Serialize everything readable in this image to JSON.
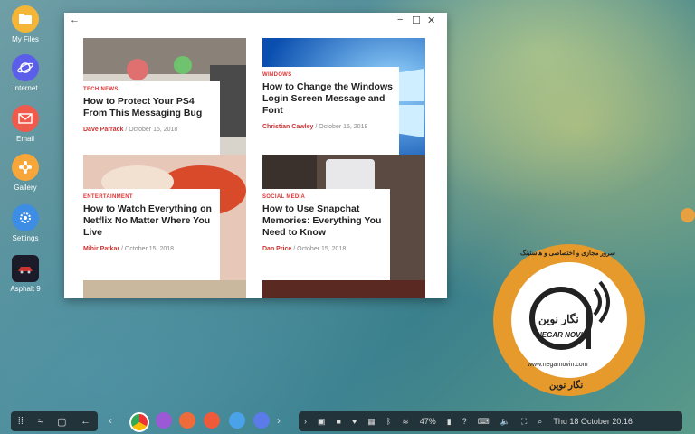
{
  "desktop": {
    "icons": [
      {
        "label": "My Files",
        "icon": "folder-icon",
        "color": "#f5b638"
      },
      {
        "label": "Internet",
        "icon": "planet-icon",
        "color": "#5b5ee8"
      },
      {
        "label": "Email",
        "icon": "envelope-icon",
        "color": "#ef5a4c"
      },
      {
        "label": "Gallery",
        "icon": "flower-icon",
        "color": "#f7a63a"
      },
      {
        "label": "Settings",
        "icon": "gear-icon",
        "color": "#3d8de5"
      },
      {
        "label": "Asphalt 9",
        "icon": "car-icon",
        "color": "#c33"
      }
    ]
  },
  "window": {
    "articles": [
      {
        "category": "TECH NEWS",
        "title": "How to Protect Your PS4 From This Messaging Bug",
        "author": "Dave Parrack",
        "date": "October 15, 2018"
      },
      {
        "category": "WINDOWS",
        "title": "How to Change the Windows Login Screen Message and Font",
        "author": "Christian Cawley",
        "date": "October 15, 2018"
      },
      {
        "category": "ENTERTAINMENT",
        "title": "How to Watch Everything on Netflix No Matter Where You Live",
        "author": "Mihir Patkar",
        "date": "October 15, 2018"
      },
      {
        "category": "SOCIAL MEDIA",
        "title": "How to Use Snapchat Memories: Everything You Need to Know",
        "author": "Dan Price",
        "date": "October 15, 2018"
      }
    ]
  },
  "taskbar": {
    "battery": "47%",
    "datetime": "Thu 18 October  20:16"
  },
  "logo": {
    "name_latin": "NEGAR NOVIN",
    "name_persian": "نگار نوین",
    "website": "www.negarnovin.com",
    "tagline_persian": "سرور مجازی و اختصاصی و هاستینگ"
  },
  "colors": {
    "accent_red": "#d33",
    "taskbar": "#22333a",
    "logo_orange": "#e79a2c"
  }
}
